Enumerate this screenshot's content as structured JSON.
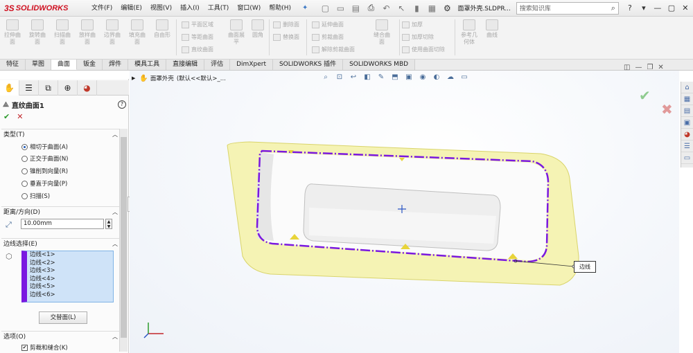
{
  "app": {
    "brand_prefix": "3S",
    "brand": "SOLIDWORKS"
  },
  "menu": [
    "文件(F)",
    "编辑(E)",
    "视图(V)",
    "插入(I)",
    "工具(T)",
    "窗口(W)",
    "帮助(H)"
  ],
  "document_title": "面罩外壳.SLDPR...",
  "search": {
    "placeholder": "搜索知识库"
  },
  "ribbon": {
    "large_buttons": [
      "拉伸曲面",
      "旋转曲面",
      "扫描曲面",
      "放样曲面",
      "边界曲面",
      "填充曲面",
      "自由形"
    ],
    "group1": [
      "平面区域",
      "等距曲面",
      "直纹曲面"
    ],
    "surface_flatten": "曲面展平",
    "fillet": "圆角",
    "group2": [
      "删除面",
      "替换面"
    ],
    "group3": [
      "延伸曲面",
      "剪裁曲面",
      "解除剪裁曲面"
    ],
    "knit": "缝合曲面",
    "group4": [
      "加厚",
      "加厚切除",
      "使用曲面切除"
    ],
    "ref_geometry": "参考几何体",
    "curves": "曲线"
  },
  "tabs": [
    "特征",
    "草图",
    "曲面",
    "钣金",
    "焊件",
    "模具工具",
    "直接编辑",
    "评估",
    "DimXpert",
    "SOLIDWORKS 插件",
    "SOLIDWORKS MBD"
  ],
  "active_tab": "曲面",
  "breadcrumb": {
    "part": "面罩外壳",
    "config": "(默认<<默认>_..."
  },
  "feature": {
    "title": "直纹曲面1",
    "type_section": "类型(T)",
    "types": [
      "相切于曲面(A)",
      "正交于曲面(N)",
      "锥削到向量(R)",
      "垂直于向量(P)",
      "扫描(S)"
    ],
    "selected_type_index": 0,
    "distance_section": "距离/方向(D)",
    "distance_value": "10.00mm",
    "edge_section": "边线选择(E)",
    "edges": [
      "边线<1>",
      "边线<2>",
      "边线<3>",
      "边线<4>",
      "边线<5>",
      "边线<6>"
    ],
    "alt_face_button": "交替面(L)",
    "options_section": "选项(O)",
    "trim_knit": "剪裁和缝合(K)",
    "trim_knit_checked": true
  },
  "callout": "边线",
  "colors": {
    "accent": "#d01020",
    "selection": "#7a18e0",
    "surface": "#f2f0a8",
    "ok": "#2c9b2c",
    "cancel": "#c2262b"
  }
}
